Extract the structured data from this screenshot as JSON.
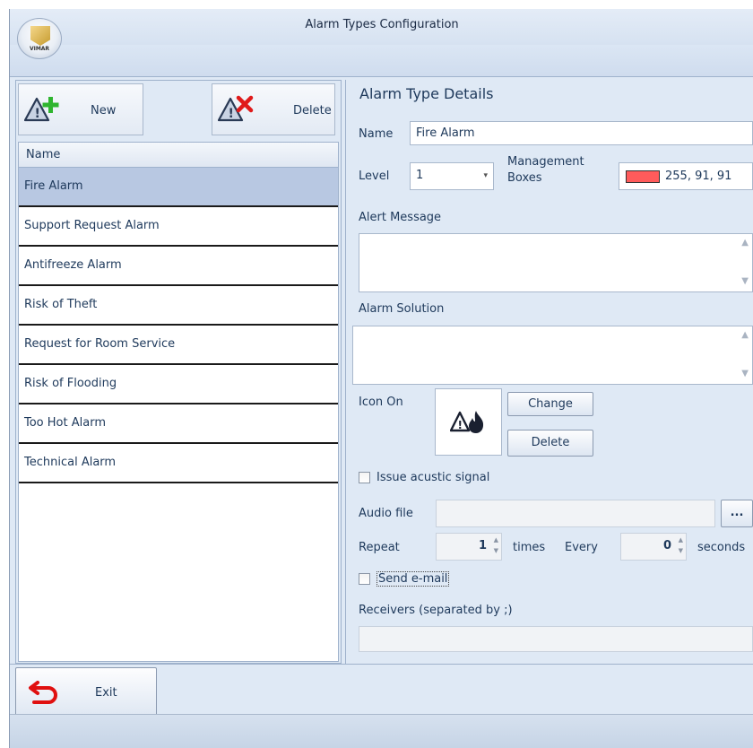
{
  "window": {
    "title": "Alarm Types Configuration",
    "app_logo_text": "VIMAR"
  },
  "toolbar": {
    "new_label": "New",
    "delete_label": "Delete"
  },
  "alarm_list": {
    "header": "Name",
    "items": [
      "Fire Alarm",
      "Support Request Alarm",
      "Antifreeze Alarm",
      "Risk of Theft",
      "Request for Room Service",
      "Risk of Flooding",
      "Too Hot Alarm",
      "Technical Alarm"
    ],
    "selected_index": 0
  },
  "details": {
    "title": "Alarm Type Details",
    "name_label": "Name",
    "name_value": "Fire Alarm",
    "level_label": "Level",
    "level_value": "1",
    "management_boxes_label_1": "Management",
    "management_boxes_label_2": "Boxes",
    "management_boxes_color": "#ff5b5b",
    "management_boxes_value": "255, 91, 91",
    "alert_message_label": "Alert Message",
    "alert_message_value": "",
    "alarm_solution_label": "Alarm Solution",
    "alarm_solution_value": "",
    "icon_on_label": "Icon On",
    "icon_name": "fire-alarm-icon",
    "change_label": "Change",
    "delete_icon_label": "Delete",
    "issue_acustic_label": "Issue acustic signal",
    "issue_acustic_checked": false,
    "audio_file_label": "Audio file",
    "audio_file_value": "",
    "browse_label": "...",
    "repeat_label": "Repeat",
    "repeat_value": "1",
    "times_label": "times",
    "every_label": "Every",
    "every_value": "0",
    "seconds_label": "seconds",
    "send_email_label": "Send e-mail",
    "send_email_checked": false,
    "receivers_label": "Receivers (separated by ;)",
    "receivers_value": ""
  },
  "footer": {
    "exit_label": "Exit"
  }
}
